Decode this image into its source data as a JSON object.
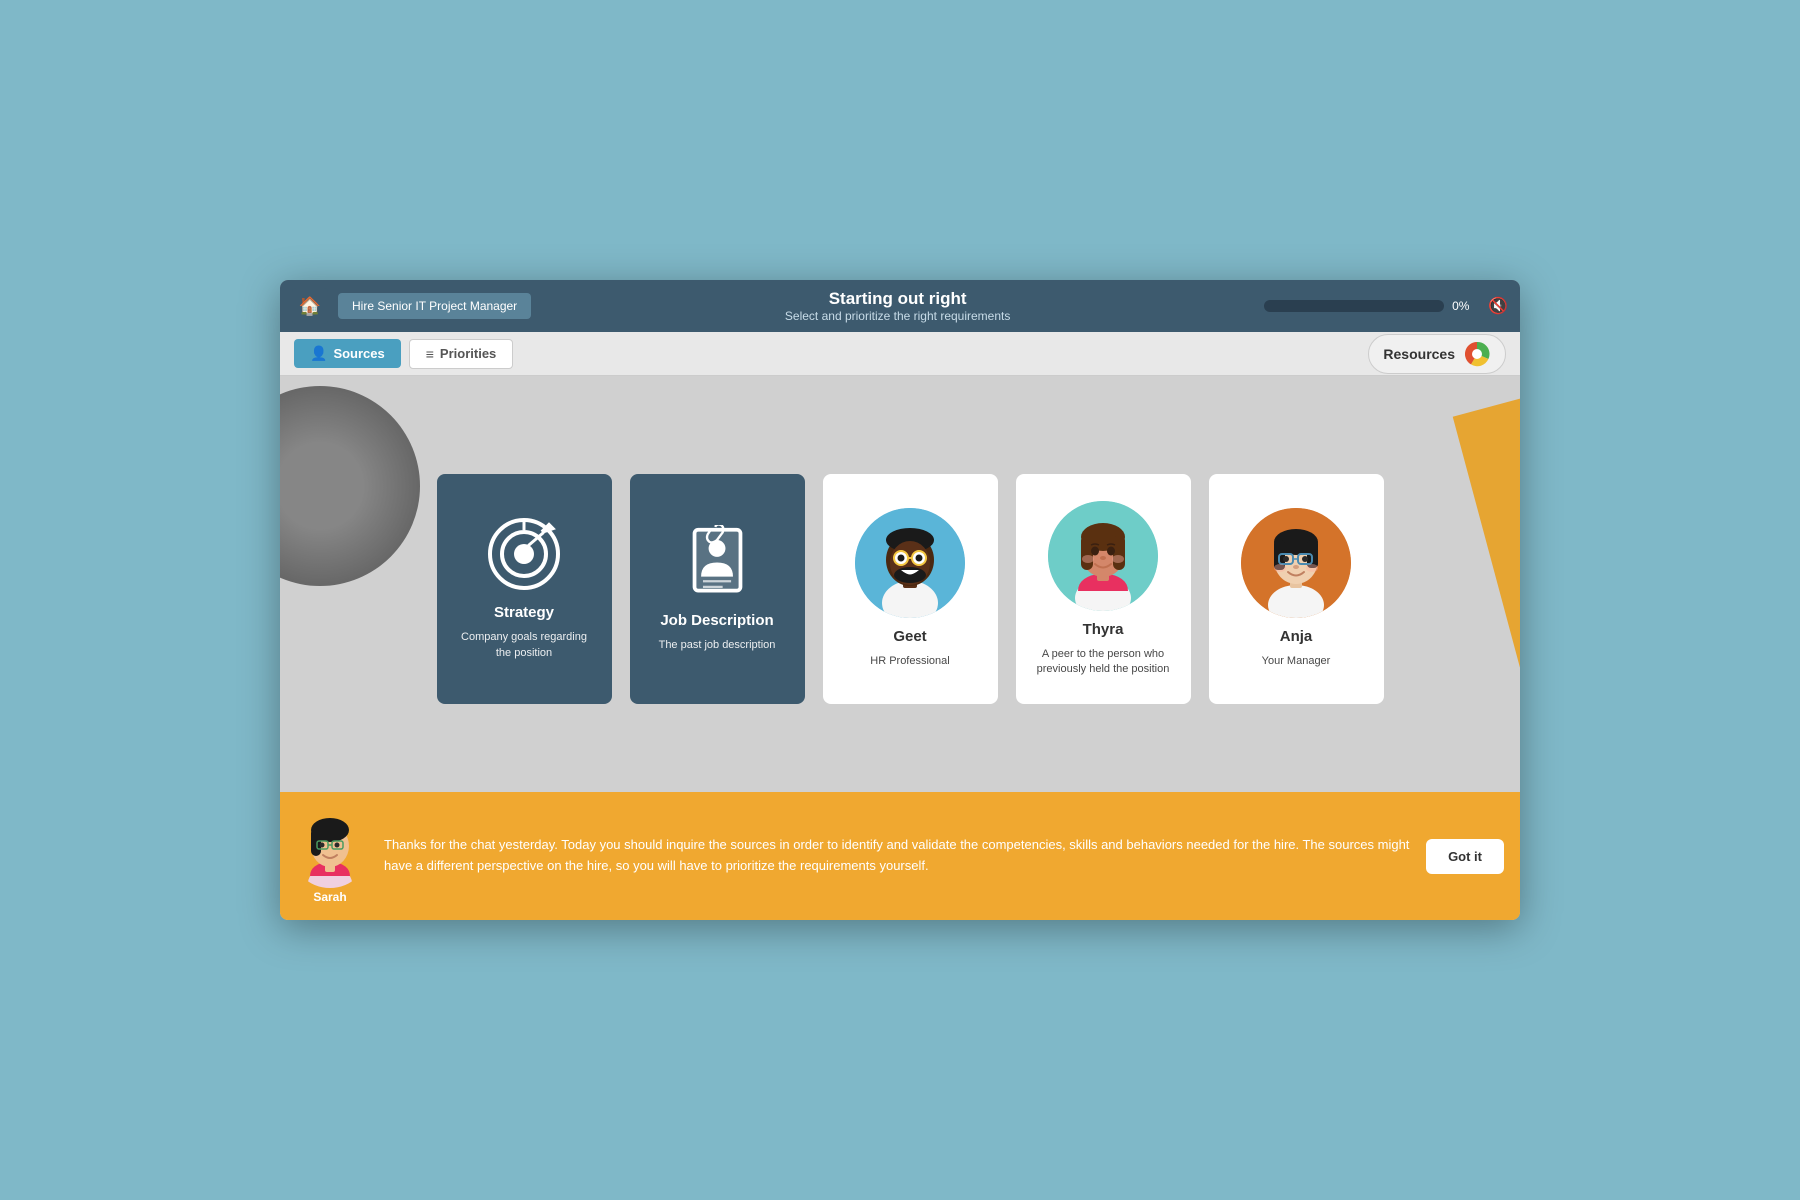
{
  "topBar": {
    "homeIcon": "🏠",
    "breadcrumb": "Hire Senior IT Project Manager",
    "title": "Starting out right",
    "subtitle": "Select and prioritize the right requirements",
    "progress": 0,
    "progressLabel": "0%",
    "soundIcon": "🔇"
  },
  "navBar": {
    "tabs": [
      {
        "id": "sources",
        "label": "Sources",
        "icon": "👤",
        "active": true
      },
      {
        "id": "priorities",
        "label": "Priorities",
        "icon": "≡",
        "active": false
      }
    ],
    "resourcesLabel": "Resources"
  },
  "cards": [
    {
      "id": "strategy",
      "type": "dark",
      "title": "Strategy",
      "subtitle": "Company goals regarding the position",
      "hasAvatar": false
    },
    {
      "id": "job-description",
      "type": "dark",
      "title": "Job Description",
      "subtitle": "The past job description",
      "hasAvatar": false
    },
    {
      "id": "geet",
      "type": "white",
      "title": "Geet",
      "subtitle": "HR Professional",
      "hasAvatar": true,
      "avatarType": "geet"
    },
    {
      "id": "thyra",
      "type": "white",
      "title": "Thyra",
      "subtitle": "A peer to the person who previously held the position",
      "hasAvatar": true,
      "avatarType": "thyra"
    },
    {
      "id": "anja",
      "type": "white",
      "title": "Anja",
      "subtitle": "Your Manager",
      "hasAvatar": true,
      "avatarType": "anja"
    }
  ],
  "chatBar": {
    "speakerName": "Sarah",
    "message": "Thanks for the chat yesterday. Today you should inquire the sources in order to identify and validate the competencies, skills and behaviors needed for the hire. The sources might have a different perspective on the hire, so you will have to prioritize the requirements yourself.",
    "gotItLabel": "Got it"
  }
}
